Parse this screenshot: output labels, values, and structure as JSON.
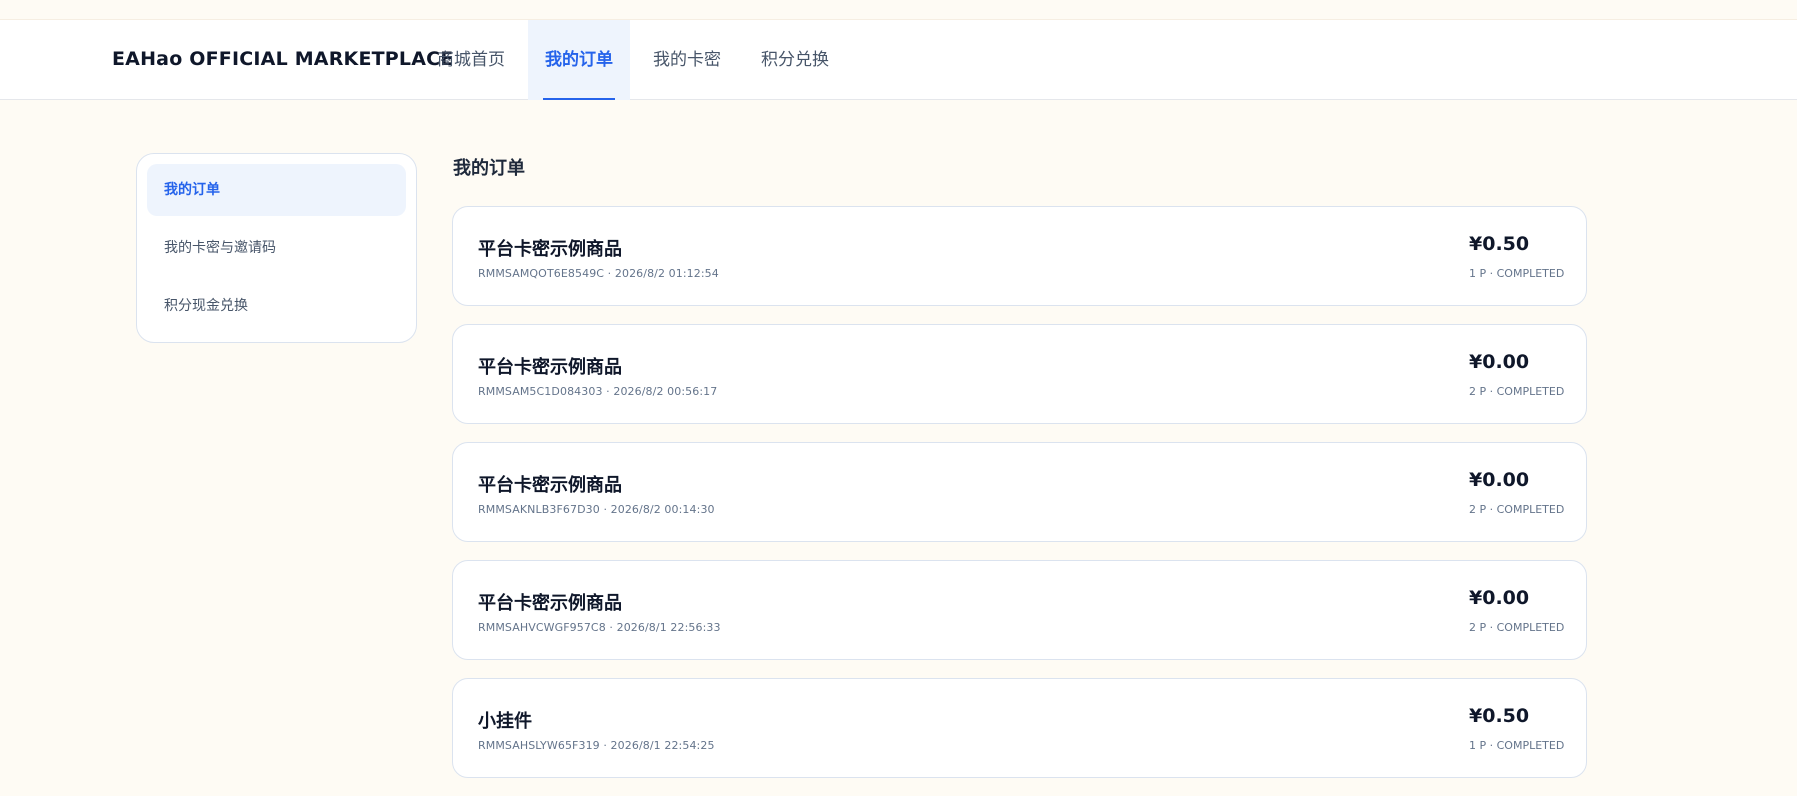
{
  "brand": "EAHao OFFICIAL MARKETPLACE",
  "nav": [
    {
      "label": "商城首页",
      "active": false
    },
    {
      "label": "我的订单",
      "active": true
    },
    {
      "label": "我的卡密",
      "active": false
    },
    {
      "label": "积分兑换",
      "active": false
    }
  ],
  "sidebar": {
    "items": [
      {
        "label": "我的订单",
        "active": true
      },
      {
        "label": "我的卡密与邀请码",
        "active": false
      },
      {
        "label": "积分现金兑换",
        "active": false
      }
    ]
  },
  "content": {
    "title": "我的订单"
  },
  "orders": [
    {
      "name": "平台卡密示例商品",
      "meta": "RMMSAMQOT6E8549C · 2026/8/2 01:12:54",
      "price": "¥0.50",
      "status": "1 P · COMPLETED"
    },
    {
      "name": "平台卡密示例商品",
      "meta": "RMMSAM5C1D084303 · 2026/8/2 00:56:17",
      "price": "¥0.00",
      "status": "2 P · COMPLETED"
    },
    {
      "name": "平台卡密示例商品",
      "meta": "RMMSAKNLB3F67D30 · 2026/8/2 00:14:30",
      "price": "¥0.00",
      "status": "2 P · COMPLETED"
    },
    {
      "name": "平台卡密示例商品",
      "meta": "RMMSAHVCWGF957C8 · 2026/8/1 22:56:33",
      "price": "¥0.00",
      "status": "2 P · COMPLETED"
    },
    {
      "name": "小挂件",
      "meta": "RMMSAHSLYW65F319 · 2026/8/1 22:54:25",
      "price": "¥0.50",
      "status": "1 P · COMPLETED"
    }
  ],
  "colors": {
    "accent": "#2563eb",
    "page_bg": "#fefbf4",
    "card_border": "#dbe3ef"
  }
}
